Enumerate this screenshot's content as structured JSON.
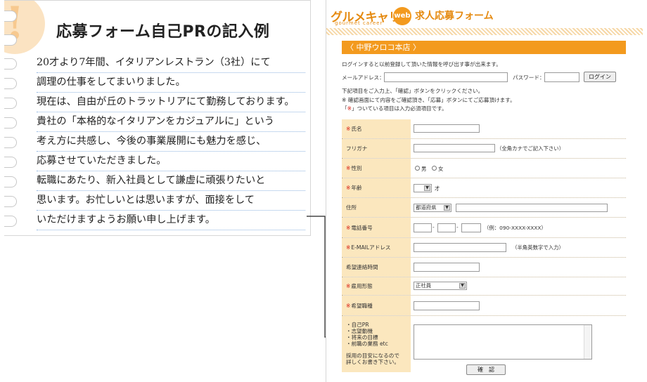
{
  "memo": {
    "badge": "!",
    "title": "応募フォーム自己PRの記入例",
    "lines": [
      "20才より7年間、イタリアンレストラン（3社）にて",
      "調理の仕事をしてまいりました。",
      "現在は、自由が丘のトラットリアにて勤務しております。",
      "貴社の「本格的なイタリアンをカジュアルに」という",
      "考え方に共感し、今後の事業展開にも魅力を感じ、",
      "応募させていただきました。",
      "転職にあたり、新入社員として謙虚に頑張りたいと",
      "思います。お忙しいとは思いますが、面接をして",
      "いただけますようお願い申し上げます。"
    ]
  },
  "header": {
    "logo": "グルメキャリー",
    "logo_sub": "gourmet career",
    "web_badge": "web",
    "title": "求人応募フォーム"
  },
  "shop_bar": "〈 中野ウロコ本店 〉",
  "intro": "ログインすると以前登録して頂いた情報を呼び出す事が出来ます。",
  "login": {
    "email_label": "メールアドレス：",
    "password_label": "パスワード：",
    "button": "ログイン"
  },
  "notes": [
    "下記項目をご入力上、「確認」ボタンをクリックください。",
    "※ 確認画面にて内容をご確認頂き、「応募」ボタンにてご応募頂けます。"
  ],
  "required_mark": "※",
  "required_note": "」ついている項目は入力必須項目です。",
  "required_note_prefix": "「",
  "fields": {
    "name": "氏名",
    "furigana": "フリガナ",
    "furigana_hint": "（全角カナでご記入下さい）",
    "gender": "性別",
    "male": "男",
    "female": "女",
    "age": "年齢",
    "age_unit": "才",
    "address": "住所",
    "prefecture": "都道府県",
    "phone": "電話番号",
    "phone_hint": "（例：090-XXXX-XXXX）",
    "email": "E-MAILアドレス",
    "email_hint": "（半角英数字で入力）",
    "contact_time": "希望連絡時間",
    "employment": "雇用形態",
    "employment_value": "正社員",
    "job": "希望職種",
    "pr_items": [
      "・自己PR",
      "・志望動機",
      "・将来の目標",
      "・前職の業務 etc"
    ],
    "pr_note": [
      "採用の目安になるので",
      "詳しくお書き下さい。"
    ]
  },
  "confirm_button": "確　認"
}
